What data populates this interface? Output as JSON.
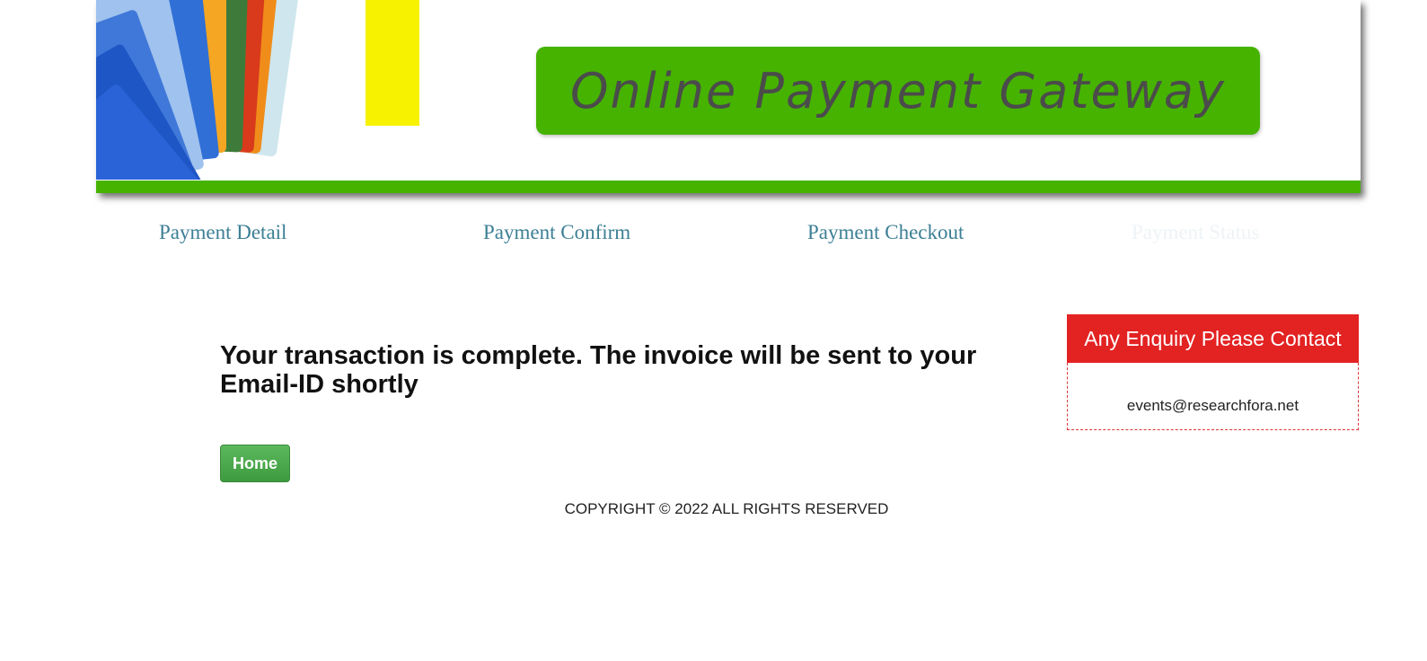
{
  "colors": {
    "brand_green": "#46b300",
    "nav_link": "#3c7f95",
    "nav_inactive": "#eef3f6",
    "enquiry_red": "#e32222",
    "home_button": "#4cae4c"
  },
  "banner": {
    "title": "Online Payment Gateway",
    "graphic": "credit-cards-fan"
  },
  "steps": [
    {
      "label": "Payment Detail"
    },
    {
      "label": "Payment Confirm"
    },
    {
      "label": "Payment Checkout"
    },
    {
      "label": "Payment Status"
    }
  ],
  "main": {
    "message": "Your transaction is complete. The invoice will be sent to your Email-ID shortly",
    "home_label": "Home"
  },
  "enquiry": {
    "heading": "Any Enquiry Please Contact",
    "email": "events@researchfora.net"
  },
  "footer": {
    "copyright": "COPYRIGHT © 2022 ALL RIGHTS RESERVED"
  }
}
